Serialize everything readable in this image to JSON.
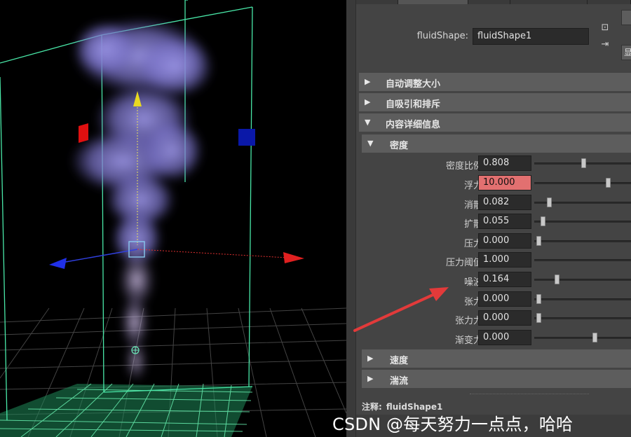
{
  "attribute_editor": {
    "shape_label": "fluidShape:",
    "shape_name": "fluidShape1",
    "side_icons": [
      "input-output-icon",
      "connection-icon"
    ],
    "side_button_label": "显",
    "collapsed_sections": [
      "自动调整大小",
      "自吸引和排斥"
    ],
    "contents_section": "内容详细信息",
    "density_section": "密度",
    "density_rows": [
      {
        "label": "密度比例",
        "value": "0.808",
        "slider": 0.46,
        "highlight": false
      },
      {
        "label": "浮力",
        "value": "10.000",
        "slider": 0.7,
        "highlight": true
      },
      {
        "label": "消散",
        "value": "0.082",
        "slider": 0.12,
        "highlight": false
      },
      {
        "label": "扩散",
        "value": "0.055",
        "slider": 0.06,
        "highlight": false
      },
      {
        "label": "压力",
        "value": "0.000",
        "slider": 0.02,
        "highlight": false
      },
      {
        "label": "压力阈值",
        "value": "1.000",
        "slider": null,
        "highlight": false
      },
      {
        "label": "噪波",
        "value": "0.164",
        "slider": 0.2,
        "highlight": false
      },
      {
        "label": "张力",
        "value": "0.000",
        "slider": 0.02,
        "highlight": false
      },
      {
        "label": "张力力",
        "value": "0.000",
        "slider": 0.02,
        "highlight": false
      },
      {
        "label": "渐变力",
        "value": "0.000",
        "slider": 0.57,
        "highlight": false
      }
    ],
    "sub_sections": [
      "速度",
      "湍流"
    ],
    "notes_label": "注释:",
    "notes_value": "fluidShape1"
  },
  "watermark": "CSDN @每天努力一点点，哈哈",
  "colors": {
    "highlight_field": "#e27070",
    "annotation_arrow": "#e23a3a",
    "bounding_box": "#49e8a8",
    "smoke": "#8a86d8"
  }
}
